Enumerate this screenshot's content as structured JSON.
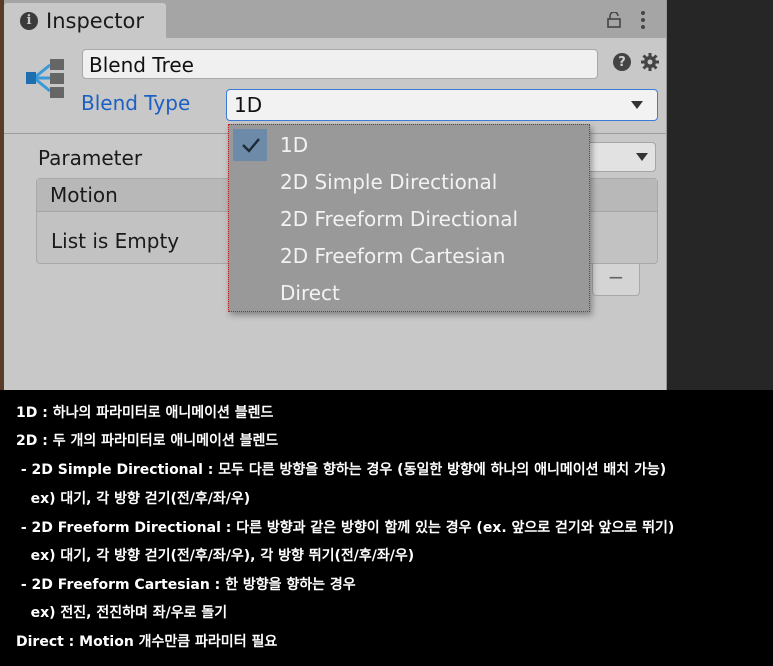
{
  "inspector": {
    "tab_title": "Inspector",
    "name_value": "Blend Tree",
    "blend_type_label": "Blend Type",
    "blend_type_value": "1D",
    "parameter_label": "Parameter",
    "motion_header": "Motion",
    "list_empty": "List is Empty",
    "minus_label": "−"
  },
  "dropdown": {
    "options": [
      "1D",
      "2D Simple Directional",
      "2D Freeform Directional",
      "2D Freeform Cartesian",
      "Direct"
    ],
    "selected": "1D"
  },
  "notes": [
    "1D : 하나의 파라미터로 애니메이션 블렌드",
    "2D : 두 개의 파라미터로 애니메이션 블렌드",
    " - 2D Simple Directional : 모두 다른 방향을 향하는 경우 (동일한 방향에 하나의 애니메이션 배치 가능)",
    "   ex) 대기, 각 방향 걷기(전/후/좌/우)",
    " - 2D Freeform Directional : 다른 방향과 같은 방향이 함께 있는 경우 (ex. 앞으로 걷기와 앞으로 뛰기)",
    "   ex) 대기, 각 방향 걷기(전/후/좌/우), 각 방향 뛰기(전/후/좌/우)",
    " - 2D Freeform Cartesian : 한 방향을 향하는 경우",
    "   ex) 전진, 전진하며 좌/우로 돌기",
    "Direct : Motion 개수만큼 파라미터 필요"
  ],
  "colors": {
    "accent_blue": "#1d5fc2",
    "selected_bg": "#6d8aa8",
    "dropdown_bg": "#999999"
  },
  "icons": [
    "info-icon",
    "lock-icon",
    "menu-icon",
    "blend-tree-icon",
    "help-icon",
    "gear-icon",
    "check-icon",
    "chevron-down-icon"
  ]
}
